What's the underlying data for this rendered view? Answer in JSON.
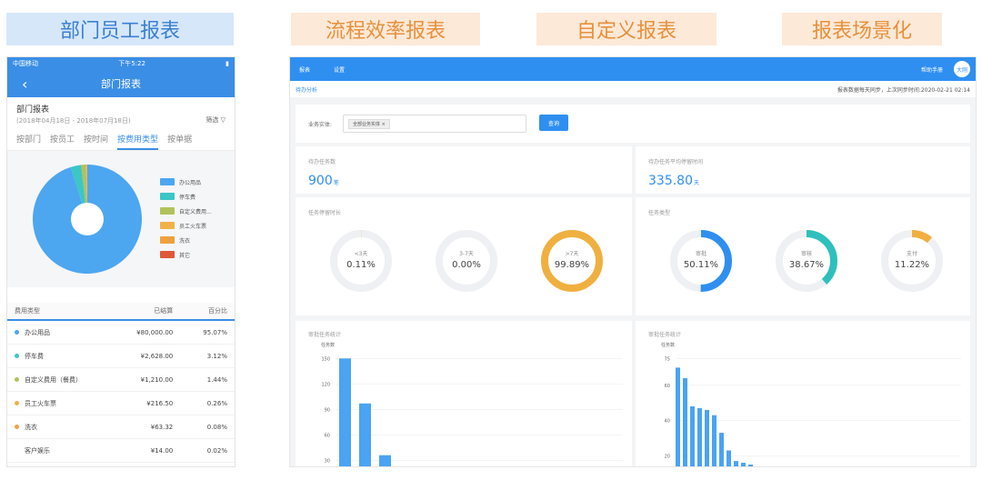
{
  "headers": {
    "tag1": "部门员工报表",
    "tag2": "流程效率报表",
    "tag3": "自定义报表",
    "tag4": "报表场景化"
  },
  "phone": {
    "status": {
      "carrier": "中国移动",
      "time": "下午5:22"
    },
    "nav_title": "部门报表",
    "report_title": "部门报表",
    "date_range": "(2018年04月18日 - 2018年07月18日)",
    "filter": "筛选",
    "tabs": [
      "按部门",
      "按员工",
      "按时间",
      "按费用类型",
      "按单据"
    ],
    "active_tab": 3,
    "legend": [
      {
        "label": "办公用品",
        "color": "#4da6f0"
      },
      {
        "label": "停车费",
        "color": "#3cc6c6"
      },
      {
        "label": "自定义费用...",
        "color": "#b2c25a"
      },
      {
        "label": "员工火车票",
        "color": "#f0b14a"
      },
      {
        "label": "洗衣",
        "color": "#f0a040"
      },
      {
        "label": "其它",
        "color": "#e0583a"
      }
    ],
    "table_headers": [
      "费用类型",
      "已结算",
      "百分比"
    ],
    "rows": [
      {
        "type": "办公用品",
        "amount": "¥80,000.00",
        "pct": "95.07%",
        "color": "#4da6f0"
      },
      {
        "type": "停车费",
        "amount": "¥2,628.00",
        "pct": "3.12%",
        "color": "#3cc6c6"
      },
      {
        "type": "自定义费用（餐费）",
        "amount": "¥1,210.00",
        "pct": "1.44%",
        "color": "#b2c25a"
      },
      {
        "type": "员工火车票",
        "amount": "¥216.50",
        "pct": "0.26%",
        "color": "#f0b14a"
      },
      {
        "type": "洗衣",
        "amount": "¥63.32",
        "pct": "0.08%",
        "color": "#f0a040"
      },
      {
        "type": "客户娱乐",
        "amount": "¥14.00",
        "pct": "0.02%",
        "color": ""
      }
    ]
  },
  "dashboard": {
    "nav": [
      "报表",
      "设置"
    ],
    "help": "帮助手册",
    "avatar": "大刚",
    "crumb": "待办分析",
    "sync_text": "报表数据每天同步，上次同步时间:2020-02-21 02:14",
    "filter_label": "业务实体:",
    "filter_chip": "全部业务实体 ×",
    "query_button": "查询",
    "kpi1_label": "待办任务数",
    "kpi1_value": "900",
    "kpi1_unit": "笔",
    "kpi2_label": "待办任务平均停留时间",
    "kpi2_value": "335.80",
    "kpi2_unit": "天",
    "dur_title": "任务停留时长",
    "type_title": "任务类型",
    "dur_rings": [
      {
        "label": "<3天",
        "value": "0.11%",
        "frac": 0.0011,
        "color": "#f0b040"
      },
      {
        "label": "3-7天",
        "value": "0.00%",
        "frac": 0.0,
        "color": "#f0b040"
      },
      {
        "label": ">7天",
        "value": "99.89%",
        "frac": 0.9989,
        "color": "#f0b040"
      }
    ],
    "type_rings": [
      {
        "label": "审批",
        "value": "50.11%",
        "frac": 0.5011,
        "color": "#2f8ff0"
      },
      {
        "label": "审核",
        "value": "38.67%",
        "frac": 0.3867,
        "color": "#2ec0bc"
      },
      {
        "label": "支付",
        "value": "11.22%",
        "frac": 0.1122,
        "color": "#f0b040"
      }
    ],
    "bar1_title": "审批任务统计",
    "bar2_title": "审批任务统计",
    "bar_ylabel": "任务数"
  },
  "chart_data": [
    {
      "type": "pie",
      "categories": [
        "办公用品",
        "停车费",
        "自定义费用（餐费）",
        "员工火车票",
        "洗衣",
        "客户娱乐"
      ],
      "values": [
        95.07,
        3.12,
        1.44,
        0.26,
        0.08,
        0.02
      ]
    },
    {
      "type": "bar",
      "title": "审批任务统计",
      "ylabel": "任务数",
      "yticks": [
        30,
        60,
        90,
        120,
        150
      ],
      "ylim": [
        25,
        160
      ],
      "values": [
        150,
        97,
        36
      ]
    },
    {
      "type": "bar",
      "title": "审批任务统计",
      "ylabel": "任务数",
      "yticks": [
        20,
        40,
        60,
        75
      ],
      "ylim": [
        15,
        80
      ],
      "values": [
        70,
        64,
        48,
        47,
        46,
        43,
        33,
        23,
        17,
        16,
        15
      ]
    }
  ]
}
